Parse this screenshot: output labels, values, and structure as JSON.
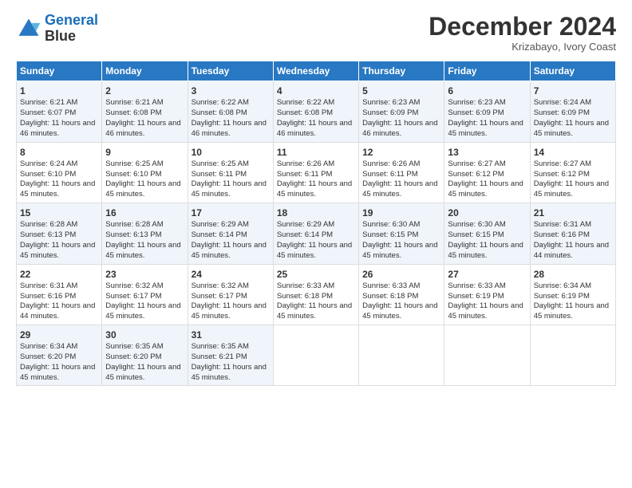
{
  "header": {
    "logo_line1": "General",
    "logo_line2": "Blue",
    "month_title": "December 2024",
    "subtitle": "Krizabayo, Ivory Coast"
  },
  "calendar": {
    "days_of_week": [
      "Sunday",
      "Monday",
      "Tuesday",
      "Wednesday",
      "Thursday",
      "Friday",
      "Saturday"
    ],
    "weeks": [
      [
        {
          "day": "",
          "sunrise": "",
          "sunset": "",
          "daylight": ""
        },
        {
          "day": "",
          "sunrise": "",
          "sunset": "",
          "daylight": ""
        },
        {
          "day": "",
          "sunrise": "",
          "sunset": "",
          "daylight": ""
        },
        {
          "day": "",
          "sunrise": "",
          "sunset": "",
          "daylight": ""
        },
        {
          "day": "",
          "sunrise": "",
          "sunset": "",
          "daylight": ""
        },
        {
          "day": "",
          "sunrise": "",
          "sunset": "",
          "daylight": ""
        },
        {
          "day": "",
          "sunrise": "",
          "sunset": "",
          "daylight": ""
        }
      ],
      [
        {
          "day": "1",
          "sunrise": "Sunrise: 6:21 AM",
          "sunset": "Sunset: 6:07 PM",
          "daylight": "Daylight: 11 hours and 46 minutes."
        },
        {
          "day": "2",
          "sunrise": "Sunrise: 6:21 AM",
          "sunset": "Sunset: 6:08 PM",
          "daylight": "Daylight: 11 hours and 46 minutes."
        },
        {
          "day": "3",
          "sunrise": "Sunrise: 6:22 AM",
          "sunset": "Sunset: 6:08 PM",
          "daylight": "Daylight: 11 hours and 46 minutes."
        },
        {
          "day": "4",
          "sunrise": "Sunrise: 6:22 AM",
          "sunset": "Sunset: 6:08 PM",
          "daylight": "Daylight: 11 hours and 46 minutes."
        },
        {
          "day": "5",
          "sunrise": "Sunrise: 6:23 AM",
          "sunset": "Sunset: 6:09 PM",
          "daylight": "Daylight: 11 hours and 46 minutes."
        },
        {
          "day": "6",
          "sunrise": "Sunrise: 6:23 AM",
          "sunset": "Sunset: 6:09 PM",
          "daylight": "Daylight: 11 hours and 45 minutes."
        },
        {
          "day": "7",
          "sunrise": "Sunrise: 6:24 AM",
          "sunset": "Sunset: 6:09 PM",
          "daylight": "Daylight: 11 hours and 45 minutes."
        }
      ],
      [
        {
          "day": "8",
          "sunrise": "Sunrise: 6:24 AM",
          "sunset": "Sunset: 6:10 PM",
          "daylight": "Daylight: 11 hours and 45 minutes."
        },
        {
          "day": "9",
          "sunrise": "Sunrise: 6:25 AM",
          "sunset": "Sunset: 6:10 PM",
          "daylight": "Daylight: 11 hours and 45 minutes."
        },
        {
          "day": "10",
          "sunrise": "Sunrise: 6:25 AM",
          "sunset": "Sunset: 6:11 PM",
          "daylight": "Daylight: 11 hours and 45 minutes."
        },
        {
          "day": "11",
          "sunrise": "Sunrise: 6:26 AM",
          "sunset": "Sunset: 6:11 PM",
          "daylight": "Daylight: 11 hours and 45 minutes."
        },
        {
          "day": "12",
          "sunrise": "Sunrise: 6:26 AM",
          "sunset": "Sunset: 6:11 PM",
          "daylight": "Daylight: 11 hours and 45 minutes."
        },
        {
          "day": "13",
          "sunrise": "Sunrise: 6:27 AM",
          "sunset": "Sunset: 6:12 PM",
          "daylight": "Daylight: 11 hours and 45 minutes."
        },
        {
          "day": "14",
          "sunrise": "Sunrise: 6:27 AM",
          "sunset": "Sunset: 6:12 PM",
          "daylight": "Daylight: 11 hours and 45 minutes."
        }
      ],
      [
        {
          "day": "15",
          "sunrise": "Sunrise: 6:28 AM",
          "sunset": "Sunset: 6:13 PM",
          "daylight": "Daylight: 11 hours and 45 minutes."
        },
        {
          "day": "16",
          "sunrise": "Sunrise: 6:28 AM",
          "sunset": "Sunset: 6:13 PM",
          "daylight": "Daylight: 11 hours and 45 minutes."
        },
        {
          "day": "17",
          "sunrise": "Sunrise: 6:29 AM",
          "sunset": "Sunset: 6:14 PM",
          "daylight": "Daylight: 11 hours and 45 minutes."
        },
        {
          "day": "18",
          "sunrise": "Sunrise: 6:29 AM",
          "sunset": "Sunset: 6:14 PM",
          "daylight": "Daylight: 11 hours and 45 minutes."
        },
        {
          "day": "19",
          "sunrise": "Sunrise: 6:30 AM",
          "sunset": "Sunset: 6:15 PM",
          "daylight": "Daylight: 11 hours and 45 minutes."
        },
        {
          "day": "20",
          "sunrise": "Sunrise: 6:30 AM",
          "sunset": "Sunset: 6:15 PM",
          "daylight": "Daylight: 11 hours and 45 minutes."
        },
        {
          "day": "21",
          "sunrise": "Sunrise: 6:31 AM",
          "sunset": "Sunset: 6:16 PM",
          "daylight": "Daylight: 11 hours and 44 minutes."
        }
      ],
      [
        {
          "day": "22",
          "sunrise": "Sunrise: 6:31 AM",
          "sunset": "Sunset: 6:16 PM",
          "daylight": "Daylight: 11 hours and 44 minutes."
        },
        {
          "day": "23",
          "sunrise": "Sunrise: 6:32 AM",
          "sunset": "Sunset: 6:17 PM",
          "daylight": "Daylight: 11 hours and 45 minutes."
        },
        {
          "day": "24",
          "sunrise": "Sunrise: 6:32 AM",
          "sunset": "Sunset: 6:17 PM",
          "daylight": "Daylight: 11 hours and 45 minutes."
        },
        {
          "day": "25",
          "sunrise": "Sunrise: 6:33 AM",
          "sunset": "Sunset: 6:18 PM",
          "daylight": "Daylight: 11 hours and 45 minutes."
        },
        {
          "day": "26",
          "sunrise": "Sunrise: 6:33 AM",
          "sunset": "Sunset: 6:18 PM",
          "daylight": "Daylight: 11 hours and 45 minutes."
        },
        {
          "day": "27",
          "sunrise": "Sunrise: 6:33 AM",
          "sunset": "Sunset: 6:19 PM",
          "daylight": "Daylight: 11 hours and 45 minutes."
        },
        {
          "day": "28",
          "sunrise": "Sunrise: 6:34 AM",
          "sunset": "Sunset: 6:19 PM",
          "daylight": "Daylight: 11 hours and 45 minutes."
        }
      ],
      [
        {
          "day": "29",
          "sunrise": "Sunrise: 6:34 AM",
          "sunset": "Sunset: 6:20 PM",
          "daylight": "Daylight: 11 hours and 45 minutes."
        },
        {
          "day": "30",
          "sunrise": "Sunrise: 6:35 AM",
          "sunset": "Sunset: 6:20 PM",
          "daylight": "Daylight: 11 hours and 45 minutes."
        },
        {
          "day": "31",
          "sunrise": "Sunrise: 6:35 AM",
          "sunset": "Sunset: 6:21 PM",
          "daylight": "Daylight: 11 hours and 45 minutes."
        },
        {
          "day": "",
          "sunrise": "",
          "sunset": "",
          "daylight": ""
        },
        {
          "day": "",
          "sunrise": "",
          "sunset": "",
          "daylight": ""
        },
        {
          "day": "",
          "sunrise": "",
          "sunset": "",
          "daylight": ""
        },
        {
          "day": "",
          "sunrise": "",
          "sunset": "",
          "daylight": ""
        }
      ]
    ]
  }
}
